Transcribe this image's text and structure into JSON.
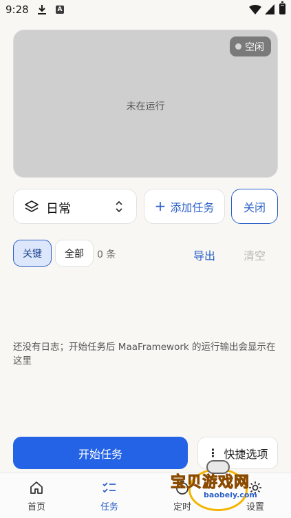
{
  "status_bar": {
    "time": "9:28"
  },
  "preview": {
    "status_label": "空闲",
    "message": "未在运行"
  },
  "controls": {
    "profile": "日常",
    "add_task_label": "添加任务",
    "close_label": "关闭"
  },
  "log": {
    "filter_key_label": "关键",
    "filter_all_label": "全部",
    "count": "0 条",
    "export_label": "导出",
    "clear_label": "清空",
    "empty_message": "还没有日志；开始任务后 MaaFramework 的运行输出会显示在这里"
  },
  "actions": {
    "start_label": "开始任务",
    "quick_label": "快捷选项"
  },
  "nav": {
    "items": [
      {
        "label": "首页",
        "icon": "home-icon"
      },
      {
        "label": "任务",
        "icon": "tasks-icon"
      },
      {
        "label": "定时",
        "icon": "timer-icon"
      },
      {
        "label": "设置",
        "icon": "settings-icon"
      }
    ]
  },
  "watermark": {
    "title": "宝贝游戏网",
    "url": "baobeiy.com"
  },
  "colors": {
    "accent": "#2463e6",
    "chip_bg": "#dde7fb",
    "background": "#f8f7f4"
  }
}
